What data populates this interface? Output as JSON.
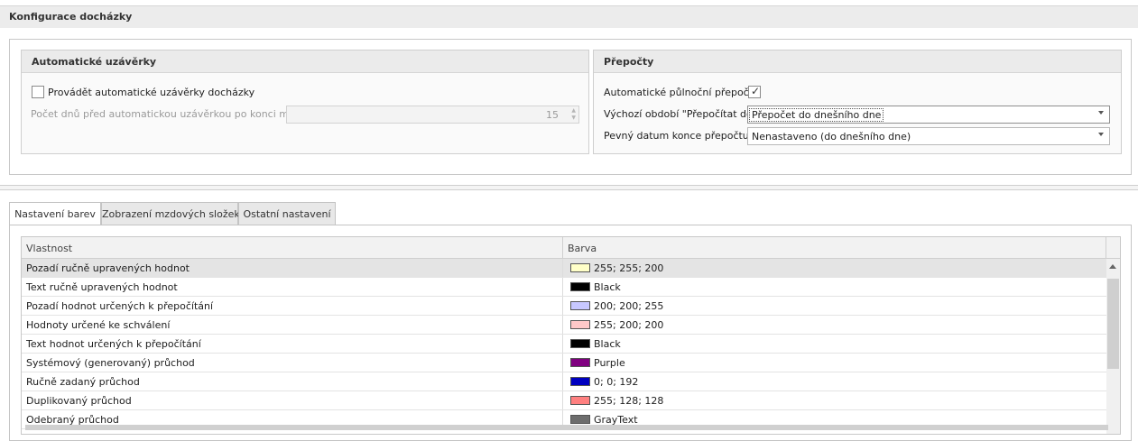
{
  "header": {
    "title": "Konfigurace docházky"
  },
  "auto_close": {
    "title": "Automatické uzávěrky",
    "enable_label": "Provádět automatické uzávěrky docházky",
    "enabled": false,
    "days_label": "Počet dnů před automatickou uzávěrkou po konci měsíce",
    "days_value": "15"
  },
  "recalc": {
    "title": "Přepočty",
    "midnight_label": "Automatické půlnoční přepočty",
    "midnight_checked": true,
    "default_period_label": "Výchozí období \"Přepočítat do\"",
    "default_period_value": "Přepočet do dnešního dne",
    "fixed_date_label": "Pevný datum konce přepočtu",
    "fixed_date_value": "Nenastaveno (do dnešního dne)"
  },
  "tabs": [
    {
      "label": "Nastavení barev",
      "active": true
    },
    {
      "label": "Zobrazení mzdových složek",
      "active": false
    },
    {
      "label": "Ostatní nastavení",
      "active": false
    }
  ],
  "grid": {
    "columns": [
      "Vlastnost",
      "Barva"
    ],
    "rows": [
      {
        "property": "Pozadí ručně upravených hodnot",
        "color_text": "255; 255; 200",
        "swatch": "#ffffc8",
        "selected": true
      },
      {
        "property": "Text ručně upravených hodnot",
        "color_text": "Black",
        "swatch": "#000000",
        "selected": false
      },
      {
        "property": "Pozadí hodnot určených k přepočítání",
        "color_text": "200; 200; 255",
        "swatch": "#c8c8ff",
        "selected": false
      },
      {
        "property": "Hodnoty určené ke schválení",
        "color_text": "255; 200; 200",
        "swatch": "#ffc8c8",
        "selected": false
      },
      {
        "property": "Text hodnot určených k přepočítání",
        "color_text": "Black",
        "swatch": "#000000",
        "selected": false
      },
      {
        "property": "Systémový (generovaný) průchod",
        "color_text": "Purple",
        "swatch": "#800080",
        "selected": false
      },
      {
        "property": "Ručně zadaný průchod",
        "color_text": "0; 0; 192",
        "swatch": "#0000c0",
        "selected": false
      },
      {
        "property": "Duplikovaný průchod",
        "color_text": "255; 128; 128",
        "swatch": "#ff8080",
        "selected": false
      },
      {
        "property": "Odebraný průchod",
        "color_text": "GrayText",
        "swatch": "#6d6d6d",
        "selected": false
      }
    ]
  }
}
